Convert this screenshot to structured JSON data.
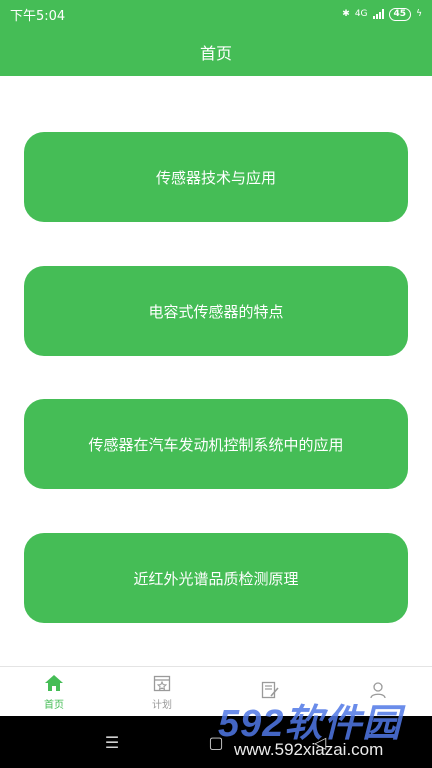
{
  "status_bar": {
    "time": "下午5:04",
    "network": "4G",
    "battery": "45"
  },
  "header": {
    "title": "首页"
  },
  "cards": [
    {
      "label": "传感器技术与应用"
    },
    {
      "label": "电容式传感器的特点"
    },
    {
      "label": "传感器在汽车发动机控制系统中的应用"
    },
    {
      "label": "近红外光谱品质检测原理"
    }
  ],
  "tabs": [
    {
      "label": "首页",
      "icon": "home-icon",
      "active": true
    },
    {
      "label": "计划",
      "icon": "calendar-icon",
      "active": false
    },
    {
      "label": "",
      "icon": "edit-icon",
      "active": false
    },
    {
      "label": "",
      "icon": "user-icon",
      "active": false
    }
  ],
  "nav_bar": {
    "menu_icon": "☰",
    "home_icon": "▢",
    "back_icon": "◁"
  },
  "watermark": {
    "brand": "592软件园",
    "url": "www.592xiazai.com"
  },
  "colors": {
    "accent": "#45bd56",
    "tab_inactive": "#9a9a9a"
  }
}
